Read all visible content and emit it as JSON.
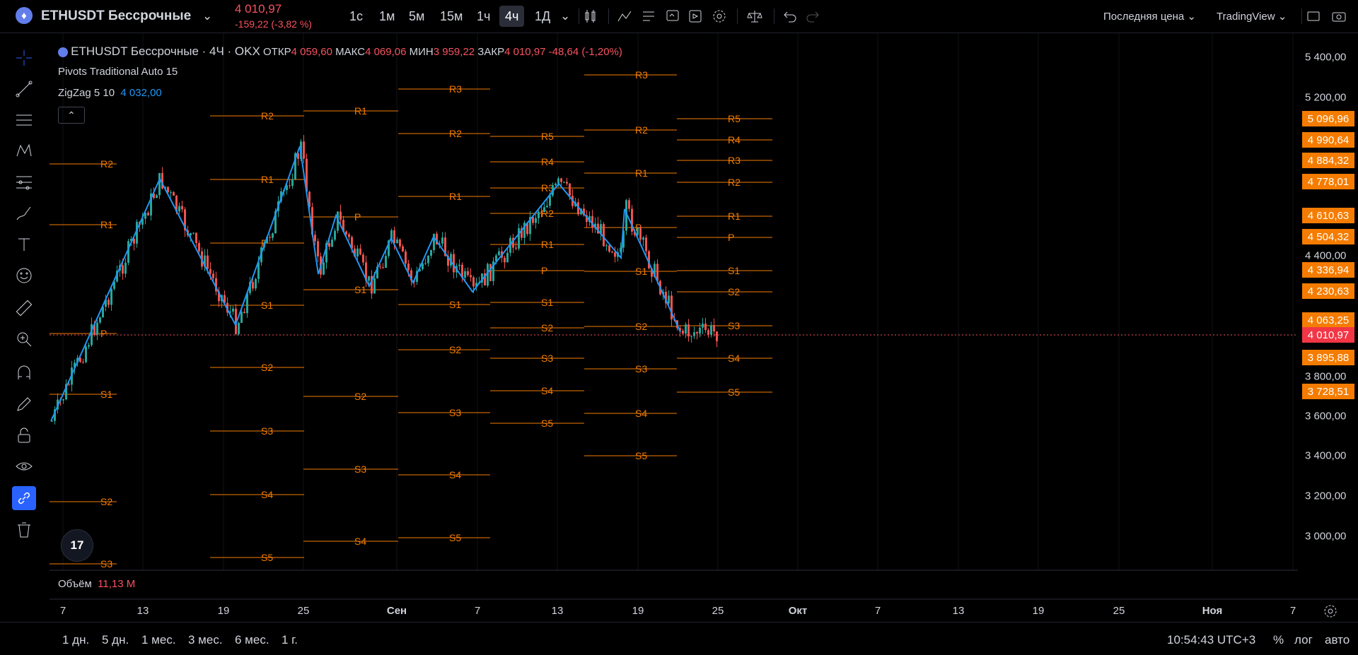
{
  "header": {
    "symbol": "ETHUSDT Бессрочные",
    "price": "4 010,97",
    "change": "-159,22 (-3,82 %)",
    "intervals": [
      "1с",
      "1м",
      "5м",
      "15м",
      "1ч",
      "4ч",
      "1Д"
    ],
    "active_interval": "4ч",
    "price_type": "Последняя цена",
    "layout_name": "TradingView"
  },
  "legend": {
    "title": "ETHUSDT Бессрочные · 4Ч · OKX",
    "open_label": "ОТКР",
    "open": "4 059,60",
    "high_label": "МАКС",
    "high": "4 069,06",
    "low_label": "МИН",
    "low": "3 959,22",
    "close_label": "ЗАКР",
    "close": "4 010,97",
    "change": "-48,64 (-1,20%)",
    "ind1": "Pivots Traditional Auto 15",
    "ind2_name": "ZigZag 5 10",
    "ind2_value": "4 032,00",
    "volume_label": "Объём",
    "volume_value": "11,13 M"
  },
  "y_axis_ticks": [
    "5 400,00",
    "5 200,00",
    "4 400,00",
    "3 800,00",
    "3 600,00",
    "3 400,00",
    "3 200,00",
    "3 000,00"
  ],
  "price_labels": [
    {
      "text": "5 096,96",
      "color": "#f57c00"
    },
    {
      "text": "4 990,64",
      "color": "#f57c00"
    },
    {
      "text": "4 884,32",
      "color": "#f57c00"
    },
    {
      "text": "4 778,01",
      "color": "#f57c00"
    },
    {
      "text": "4 610,63",
      "color": "#f57c00"
    },
    {
      "text": "4 504,32",
      "color": "#f57c00"
    },
    {
      "text": "4 336,94",
      "color": "#f57c00"
    },
    {
      "text": "4 230,63",
      "color": "#f57c00"
    },
    {
      "text": "4 063,25",
      "color": "#f57c00"
    },
    {
      "text": "4 010,97",
      "color": "#f7525f"
    },
    {
      "text": "3 895,88",
      "color": "#f57c00"
    },
    {
      "text": "3 728,51",
      "color": "#f57c00"
    }
  ],
  "x_axis": [
    "7",
    "13",
    "19",
    "25",
    "Сен",
    "7",
    "13",
    "19",
    "25",
    "Окт",
    "7",
    "13",
    "19",
    "25",
    "Ноя",
    "7"
  ],
  "ranges": [
    "1 дн.",
    "5 дн.",
    "1 мес.",
    "3 мес.",
    "6 мес.",
    "1 г."
  ],
  "clock": "10:54:43 UTC+3",
  "footer_buttons": {
    "percent": "%",
    "log": "лог",
    "auto": "авто"
  },
  "colors": {
    "pivot": "#f57c00",
    "zigzag": "#2196f3",
    "up": "#26a69a",
    "down": "#ef5350"
  }
}
